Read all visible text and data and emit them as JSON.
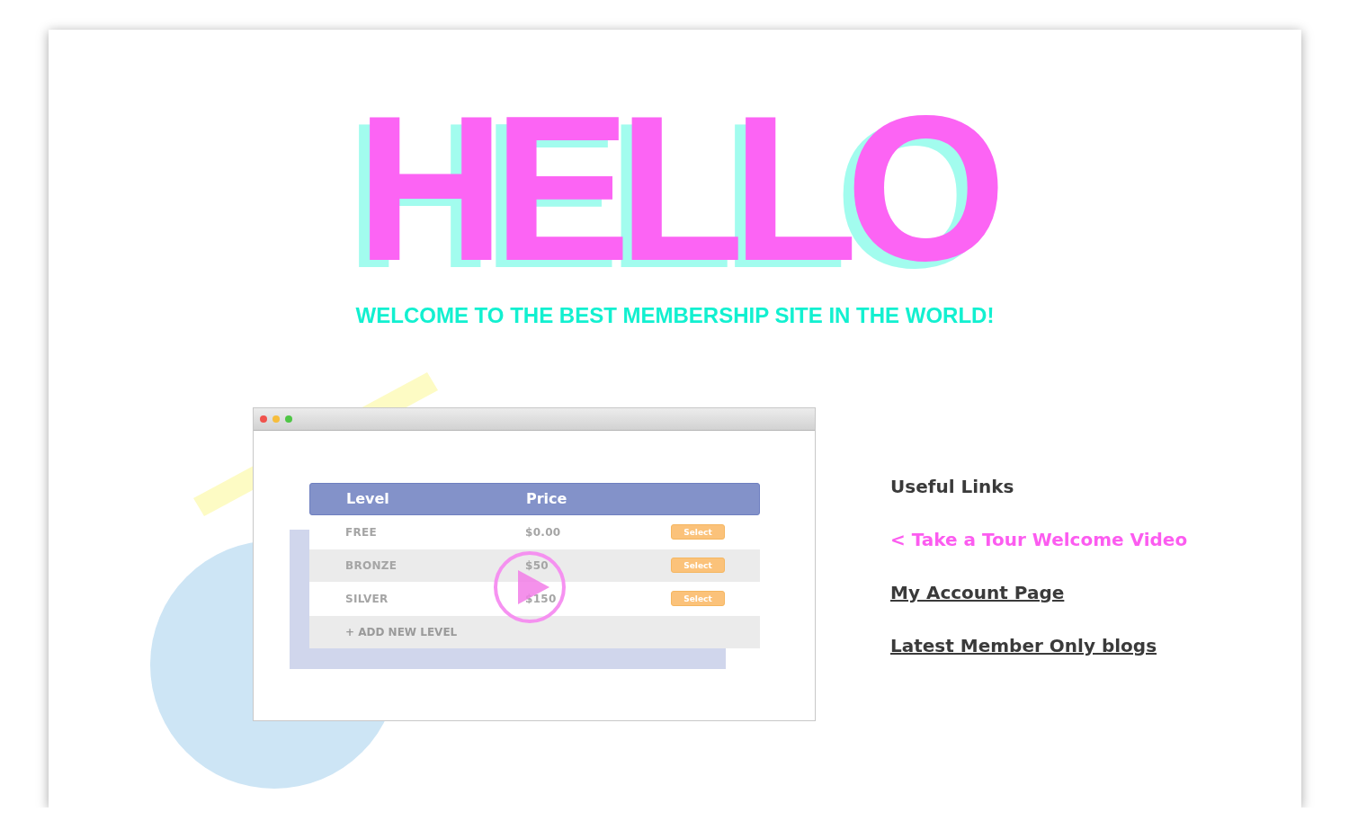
{
  "hero": {
    "title": "HELLO",
    "subtitle": "WELCOME TO THE BEST MEMBERSHIP SITE IN THE WORLD!"
  },
  "preview": {
    "table": {
      "columns": [
        "Level",
        "Price"
      ],
      "rows": [
        {
          "level": "FREE",
          "price": "$0.00",
          "action": "Select"
        },
        {
          "level": "BRONZE",
          "price": "$50",
          "action": "Select"
        },
        {
          "level": "SILVER",
          "price": "$150",
          "action": "Select"
        }
      ],
      "add_row": "+ ADD NEW LEVEL"
    }
  },
  "links": {
    "heading": "Useful Links",
    "items": [
      {
        "label": "< Take a Tour Welcome Video",
        "selected": true
      },
      {
        "label": "My Account Page",
        "selected": false
      },
      {
        "label": "Latest Member Only blogs",
        "selected": false
      }
    ]
  }
}
